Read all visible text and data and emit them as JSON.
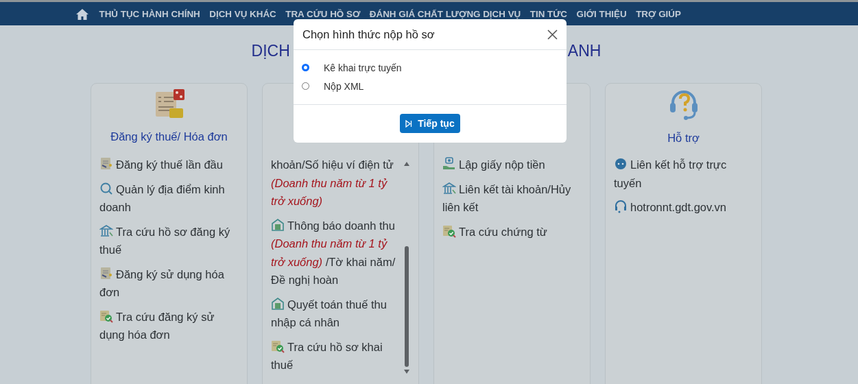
{
  "nav": {
    "items": [
      "THỦ TỤC HÀNH CHÍNH",
      "DỊCH VỤ KHÁC",
      "TRA CỨU HỒ SƠ",
      "ĐÁNH GIÁ CHẤT LƯỢNG DỊCH VỤ",
      "TIN TỨC",
      "GIỚI THIỆU",
      "TRỢ GIÚP"
    ]
  },
  "heading": {
    "left": "DỊCH",
    "right": "ANH"
  },
  "cards": [
    {
      "kind": "tax",
      "title": "Đăng ký thuế/ Hóa đơn",
      "scroll": false,
      "items": [
        {
          "kind": "doc",
          "text": "Đăng ký thuế lần đầu"
        },
        {
          "kind": "search",
          "text": "Quản lý địa điểm kinh doanh"
        },
        {
          "kind": "bank",
          "text": "Tra cứu hồ sơ đăng ký thuế"
        },
        {
          "kind": "doc",
          "text": "Đăng ký sử dụng hóa đơn"
        },
        {
          "kind": "check",
          "text": "Tra cứu đăng ký sử dụng hóa đơn"
        }
      ]
    },
    {
      "kind": "none",
      "scroll": true,
      "items": [
        {
          "kind": "none",
          "text": "khoản/Số hiệu ví điện tử *(Doanh thu năm từ 1 tỷ trở xuống)*"
        },
        {
          "kind": "house",
          "text": "Thông báo doanh thu *(Doanh thu năm từ 1 tỷ trở xuống)* /Tờ khai năm/ Đề nghị hoàn"
        },
        {
          "kind": "house",
          "text": "Quyết toán thuế thu nhập cá nhân"
        },
        {
          "kind": "check",
          "text": "Tra cứu hồ sơ khai thuế"
        }
      ]
    },
    {
      "kind": "none",
      "scroll": false,
      "items": [
        {
          "kind": "hand",
          "text": "Lập giấy nộp tiền"
        },
        {
          "kind": "bank",
          "text": "Liên kết tài khoản/Hủy liên kết"
        },
        {
          "kind": "check",
          "text": "Tra cứu chứng từ"
        }
      ]
    },
    {
      "kind": "support",
      "title": "Hỗ trợ",
      "scroll": false,
      "items": [
        {
          "kind": "chat",
          "text": "Liên kết hỗ trợ trực tuyến"
        },
        {
          "kind": "headset",
          "text": "hotronnt.gdt.gov.vn"
        }
      ]
    }
  ],
  "modal": {
    "title": "Chọn hình thức nộp hồ sơ",
    "options": [
      {
        "label": "Kê khai trực tuyến",
        "selected": true
      },
      {
        "label": "Nộp XML",
        "selected": false
      }
    ],
    "button": "Tiếp tục"
  }
}
